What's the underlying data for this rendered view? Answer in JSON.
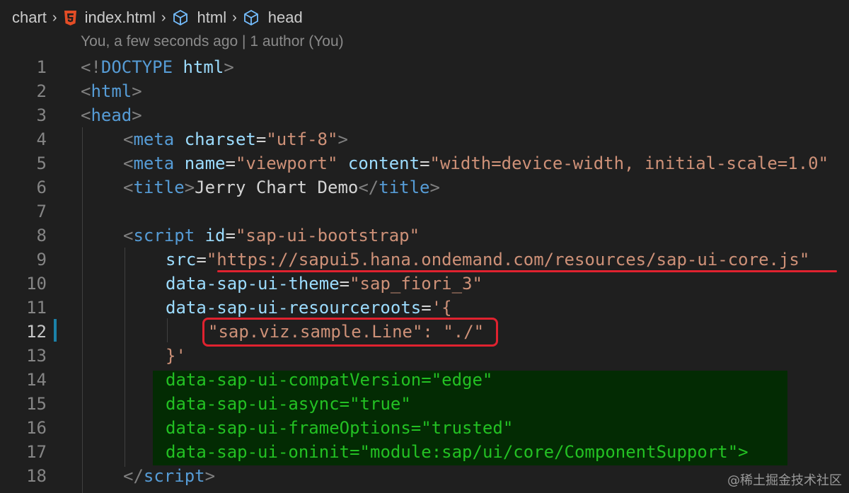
{
  "breadcrumb": {
    "folder": "chart",
    "file": "index.html",
    "node1": "html",
    "node2": "head",
    "colors": {
      "html5_icon": "#e44d26",
      "cube_icon": "#75beff"
    }
  },
  "blame": "You, a few seconds ago | 1 author (You)",
  "line_numbers": [
    "1",
    "2",
    "3",
    "4",
    "5",
    "6",
    "7",
    "8",
    "9",
    "10",
    "11",
    "12",
    "13",
    "14",
    "15",
    "16",
    "17",
    "18"
  ],
  "code": {
    "l1": {
      "open": "<!",
      "kw": "DOCTYPE",
      "sp": " ",
      "val": "html",
      "close": ">"
    },
    "l2": {
      "open": "<",
      "tag": "html",
      "close": ">"
    },
    "l3": {
      "open": "<",
      "tag": "head",
      "close": ">"
    },
    "l4": {
      "open": "<",
      "tag": "meta",
      "attr": "charset",
      "eq": "=",
      "val": "\"utf-8\"",
      "close": ">"
    },
    "l5": {
      "open": "<",
      "tag": "meta",
      "attr1": "name",
      "eq": "=",
      "val1": "\"viewport\"",
      "attr2": "content",
      "val2": "\"width=device-width, initial-scale=1.0\""
    },
    "l6": {
      "open": "<",
      "tag": "title",
      "close": ">",
      "text": "Jerry Chart Demo",
      "end_open": "</",
      "end_tag": "title",
      "end_close": ">"
    },
    "l8": {
      "open": "<",
      "tag": "script",
      "attr": "id",
      "eq": "=",
      "val": "\"sap-ui-bootstrap\""
    },
    "l9": {
      "attr": "src",
      "eq": "=",
      "val": "\"https://sapui5.hana.ondemand.com/resources/sap-ui-core.js\""
    },
    "l10": {
      "attr": "data-sap-ui-theme",
      "eq": "=",
      "val": "\"sap_fiori_3\""
    },
    "l11": {
      "attr": "data-sap-ui-resourceroots",
      "eq": "=",
      "val": "'{"
    },
    "l12": {
      "val": "\"sap.viz.sample.Line\": \"./\""
    },
    "l13": {
      "val": "}'"
    },
    "l14": {
      "attr": "data-sap-ui-compatVersion",
      "eq": "=",
      "val": "\"edge\""
    },
    "l15": {
      "attr": "data-sap-ui-async",
      "eq": "=",
      "val": "\"true\""
    },
    "l16": {
      "attr": "data-sap-ui-frameOptions",
      "eq": "=",
      "val": "\"trusted\""
    },
    "l17": {
      "attr": "data-sap-ui-oninit",
      "eq": "=",
      "val": "\"module:sap/ui/core/ComponentSupport\"",
      "close": ">"
    },
    "l18": {
      "open": "</",
      "tag": "script",
      "close": ">"
    }
  },
  "watermark": "@稀土掘金技术社区",
  "colors": {
    "background": "#1f1f1f",
    "tag": "#569cd6",
    "attribute": "#9cdcfe",
    "string": "#ce9178",
    "highlight_green": "#23c123",
    "annotation_red": "#e0222f"
  }
}
